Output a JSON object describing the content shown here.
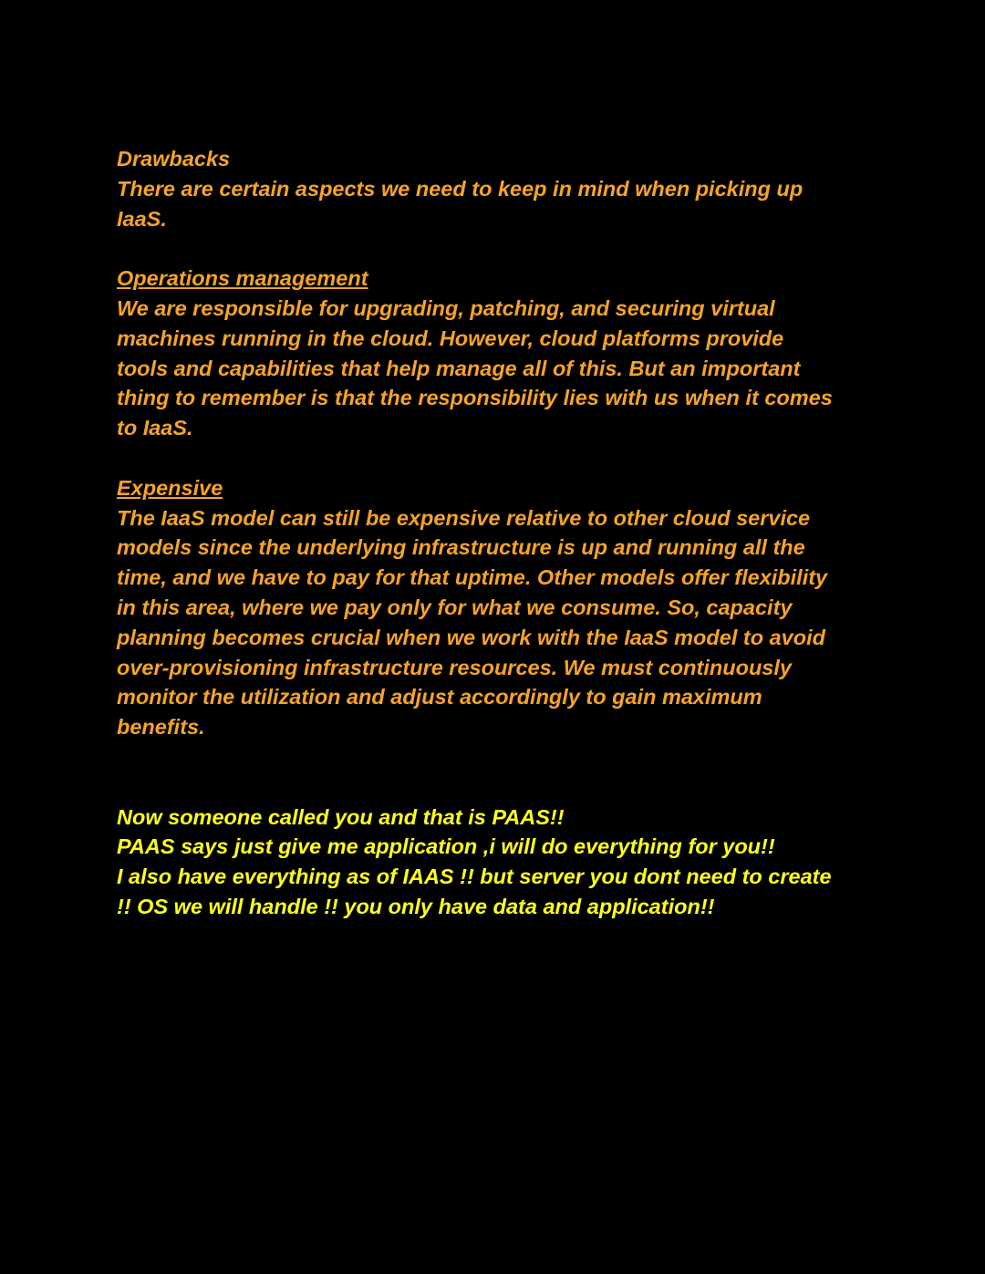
{
  "document": {
    "drawbacks": {
      "title": "Drawbacks",
      "lines": [
        "There are certain aspects we need to keep in mind when picking up",
        "IaaS."
      ]
    },
    "operations": {
      "heading": "Operations management",
      "lines": [
        "We are responsible for upgrading, patching, and securing virtual",
        "machines running in the cloud. However, cloud platforms provide",
        "tools and capabilities that help manage all of this. But an important",
        "thing to remember is that the responsibility lies with us when it comes",
        "to IaaS."
      ]
    },
    "expensive": {
      "heading": "Expensive",
      "lines": [
        "The IaaS model can still be expensive relative to other cloud service",
        "models since the underlying infrastructure is up and running all the",
        "time, and we have to pay for that uptime. Other models offer flexibility",
        "in this area, where we pay only for what we consume. So, capacity",
        "planning becomes crucial when we work with the IaaS model to avoid",
        "over-provisioning infrastructure resources. We must continuously",
        "monitor the utilization and adjust accordingly to gain maximum",
        "benefits."
      ]
    },
    "paas_note": {
      "lines": [
        "Now someone called you and that is PAAS!!",
        "PAAS says just give me application ,i will do everything for you!!",
        "I also have everything as of IAAS !! but server you dont need to create",
        "!! OS we will handle !! you only have data and application!!"
      ]
    }
  },
  "colors": {
    "background": "#000000",
    "orange_text": "#f5a32a",
    "yellow_text": "#ffff1f"
  }
}
